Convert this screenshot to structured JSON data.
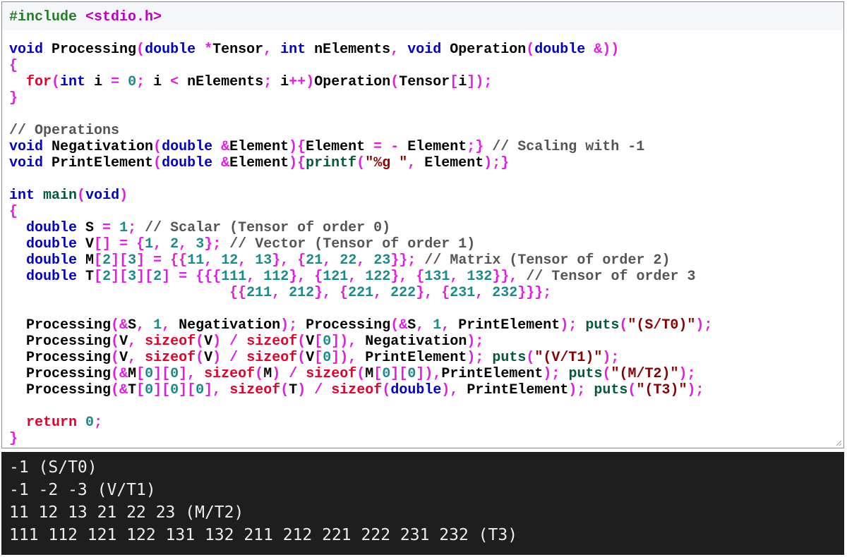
{
  "colors": {
    "editor_bg": "#ffffff",
    "first_line_bg": "#f4f6f9",
    "console_bg": "#1e1e1e",
    "console_text": "#ececec",
    "token_default": "#000000",
    "token_preprocessor": "#267f26",
    "token_include_path": "#c000c0",
    "token_type": "#0000cc",
    "token_keyword": "#e8002a",
    "token_punct": "#e619e6",
    "token_number": "#1a8b8b",
    "token_string": "#8b0000",
    "token_comment": "#555555",
    "token_function": "#005a3c"
  },
  "editor": {
    "code_lines": [
      [
        [
          "#include ",
          "p"
        ],
        [
          "<stdio.h>",
          "ip"
        ]
      ],
      [],
      [
        [
          "void",
          "t"
        ],
        [
          " Processing",
          "d"
        ],
        [
          "(",
          "x"
        ],
        [
          "double",
          "t"
        ],
        [
          " ",
          "d"
        ],
        [
          "*",
          "x"
        ],
        [
          "Tensor",
          "d"
        ],
        [
          ", ",
          "x"
        ],
        [
          "int",
          "t"
        ],
        [
          " nElements",
          "d"
        ],
        [
          ", ",
          "x"
        ],
        [
          "void",
          "t"
        ],
        [
          " Operation",
          "d"
        ],
        [
          "(",
          "x"
        ],
        [
          "double",
          "t"
        ],
        [
          " ",
          "d"
        ],
        [
          "&))",
          "x"
        ]
      ],
      [
        [
          "{",
          "x"
        ]
      ],
      [
        [
          "  ",
          "d"
        ],
        [
          "for",
          "k"
        ],
        [
          "(",
          "x"
        ],
        [
          "int",
          "t"
        ],
        [
          " i ",
          "d"
        ],
        [
          "=",
          "x"
        ],
        [
          " ",
          "d"
        ],
        [
          "0",
          "n"
        ],
        [
          "; ",
          "x"
        ],
        [
          "i ",
          "d"
        ],
        [
          "<",
          "x"
        ],
        [
          " nElements",
          "d"
        ],
        [
          "; ",
          "x"
        ],
        [
          "i",
          "d"
        ],
        [
          "++)",
          "x"
        ],
        [
          "Operation",
          "d"
        ],
        [
          "(",
          "x"
        ],
        [
          "Tensor",
          "d"
        ],
        [
          "[",
          "x"
        ],
        [
          "i",
          "d"
        ],
        [
          "]);",
          "x"
        ]
      ],
      [
        [
          "}",
          "x"
        ]
      ],
      [],
      [
        [
          "// Operations",
          "c"
        ]
      ],
      [
        [
          "void",
          "t"
        ],
        [
          " Negativation",
          "d"
        ],
        [
          "(",
          "x"
        ],
        [
          "double",
          "t"
        ],
        [
          " ",
          "d"
        ],
        [
          "&",
          "x"
        ],
        [
          "Element",
          "d"
        ],
        [
          ")",
          "x"
        ],
        [
          "{",
          "x"
        ],
        [
          "Element ",
          "d"
        ],
        [
          "=",
          "x"
        ],
        [
          " ",
          "d"
        ],
        [
          "-",
          "x"
        ],
        [
          " Element",
          "d"
        ],
        [
          ";}",
          "x"
        ],
        [
          " ",
          "d"
        ],
        [
          "// Scaling with -1",
          "c"
        ]
      ],
      [
        [
          "void",
          "t"
        ],
        [
          " PrintElement",
          "d"
        ],
        [
          "(",
          "x"
        ],
        [
          "double",
          "t"
        ],
        [
          " ",
          "d"
        ],
        [
          "&",
          "x"
        ],
        [
          "Element",
          "d"
        ],
        [
          ")",
          "x"
        ],
        [
          "{",
          "x"
        ],
        [
          "printf",
          "f"
        ],
        [
          "(",
          "x"
        ],
        [
          "\"%g \"",
          "s"
        ],
        [
          ", ",
          "x"
        ],
        [
          "Element",
          "d"
        ],
        [
          ");}",
          "x"
        ]
      ],
      [],
      [
        [
          "int",
          "t"
        ],
        [
          " ",
          "d"
        ],
        [
          "main",
          "f"
        ],
        [
          "(",
          "x"
        ],
        [
          "void",
          "t"
        ],
        [
          ")",
          "x"
        ]
      ],
      [
        [
          "{",
          "x"
        ]
      ],
      [
        [
          "  ",
          "d"
        ],
        [
          "double",
          "t"
        ],
        [
          " S ",
          "d"
        ],
        [
          "=",
          "x"
        ],
        [
          " ",
          "d"
        ],
        [
          "1",
          "n"
        ],
        [
          "; ",
          "x"
        ],
        [
          "// Scalar (Tensor of order 0)",
          "c"
        ]
      ],
      [
        [
          "  ",
          "d"
        ],
        [
          "double",
          "t"
        ],
        [
          " V",
          "d"
        ],
        [
          "[]",
          "x"
        ],
        [
          " ",
          "d"
        ],
        [
          "=",
          "x"
        ],
        [
          " ",
          "d"
        ],
        [
          "{",
          "x"
        ],
        [
          "1",
          "n"
        ],
        [
          ", ",
          "x"
        ],
        [
          "2",
          "n"
        ],
        [
          ", ",
          "x"
        ],
        [
          "3",
          "n"
        ],
        [
          "};",
          "x"
        ],
        [
          " ",
          "d"
        ],
        [
          "// Vector (Tensor of order 1)",
          "c"
        ]
      ],
      [
        [
          "  ",
          "d"
        ],
        [
          "double",
          "t"
        ],
        [
          " M",
          "d"
        ],
        [
          "[",
          "x"
        ],
        [
          "2",
          "n"
        ],
        [
          "][",
          "x"
        ],
        [
          "3",
          "n"
        ],
        [
          "]",
          "x"
        ],
        [
          " ",
          "d"
        ],
        [
          "=",
          "x"
        ],
        [
          " ",
          "d"
        ],
        [
          "{{",
          "x"
        ],
        [
          "11",
          "n"
        ],
        [
          ", ",
          "x"
        ],
        [
          "12",
          "n"
        ],
        [
          ", ",
          "x"
        ],
        [
          "13",
          "n"
        ],
        [
          "}, {",
          "x"
        ],
        [
          "21",
          "n"
        ],
        [
          ", ",
          "x"
        ],
        [
          "22",
          "n"
        ],
        [
          ", ",
          "x"
        ],
        [
          "23",
          "n"
        ],
        [
          "}};",
          "x"
        ],
        [
          " ",
          "d"
        ],
        [
          "// Matrix (Tensor of order 2)",
          "c"
        ]
      ],
      [
        [
          "  ",
          "d"
        ],
        [
          "double",
          "t"
        ],
        [
          " T",
          "d"
        ],
        [
          "[",
          "x"
        ],
        [
          "2",
          "n"
        ],
        [
          "][",
          "x"
        ],
        [
          "3",
          "n"
        ],
        [
          "][",
          "x"
        ],
        [
          "2",
          "n"
        ],
        [
          "]",
          "x"
        ],
        [
          " ",
          "d"
        ],
        [
          "=",
          "x"
        ],
        [
          " ",
          "d"
        ],
        [
          "{{{",
          "x"
        ],
        [
          "111",
          "n"
        ],
        [
          ", ",
          "x"
        ],
        [
          "112",
          "n"
        ],
        [
          "}, {",
          "x"
        ],
        [
          "121",
          "n"
        ],
        [
          ", ",
          "x"
        ],
        [
          "122",
          "n"
        ],
        [
          "}, {",
          "x"
        ],
        [
          "131",
          "n"
        ],
        [
          ", ",
          "x"
        ],
        [
          "132",
          "n"
        ],
        [
          "}},",
          "x"
        ],
        [
          " ",
          "d"
        ],
        [
          "// Tensor of order 3",
          "c"
        ]
      ],
      [
        [
          "                          ",
          "d"
        ],
        [
          "{{",
          "x"
        ],
        [
          "211",
          "n"
        ],
        [
          ", ",
          "x"
        ],
        [
          "212",
          "n"
        ],
        [
          "}, {",
          "x"
        ],
        [
          "221",
          "n"
        ],
        [
          ", ",
          "x"
        ],
        [
          "222",
          "n"
        ],
        [
          "}, {",
          "x"
        ],
        [
          "231",
          "n"
        ],
        [
          ", ",
          "x"
        ],
        [
          "232",
          "n"
        ],
        [
          "}}};",
          "x"
        ]
      ],
      [],
      [
        [
          "  ",
          "d"
        ],
        [
          "Processing",
          "d"
        ],
        [
          "(&",
          "x"
        ],
        [
          "S",
          "d"
        ],
        [
          ", ",
          "x"
        ],
        [
          "1",
          "n"
        ],
        [
          ", ",
          "x"
        ],
        [
          "Negativation",
          "d"
        ],
        [
          "); ",
          "x"
        ],
        [
          "Processing",
          "d"
        ],
        [
          "(&",
          "x"
        ],
        [
          "S",
          "d"
        ],
        [
          ", ",
          "x"
        ],
        [
          "1",
          "n"
        ],
        [
          ", ",
          "x"
        ],
        [
          "PrintElement",
          "d"
        ],
        [
          "); ",
          "x"
        ],
        [
          "puts",
          "f"
        ],
        [
          "(",
          "x"
        ],
        [
          "\"(S/T0)\"",
          "s"
        ],
        [
          ");",
          "x"
        ]
      ],
      [
        [
          "  ",
          "d"
        ],
        [
          "Processing",
          "d"
        ],
        [
          "(",
          "x"
        ],
        [
          "V",
          "d"
        ],
        [
          ", ",
          "x"
        ],
        [
          "sizeof",
          "k"
        ],
        [
          "(",
          "x"
        ],
        [
          "V",
          "d"
        ],
        [
          ")",
          "x"
        ],
        [
          " ",
          "d"
        ],
        [
          "/",
          "x"
        ],
        [
          " ",
          "d"
        ],
        [
          "sizeof",
          "k"
        ],
        [
          "(",
          "x"
        ],
        [
          "V",
          "d"
        ],
        [
          "[",
          "x"
        ],
        [
          "0",
          "n"
        ],
        [
          "]), ",
          "x"
        ],
        [
          "Negativation",
          "d"
        ],
        [
          ");",
          "x"
        ]
      ],
      [
        [
          "  ",
          "d"
        ],
        [
          "Processing",
          "d"
        ],
        [
          "(",
          "x"
        ],
        [
          "V",
          "d"
        ],
        [
          ", ",
          "x"
        ],
        [
          "sizeof",
          "k"
        ],
        [
          "(",
          "x"
        ],
        [
          "V",
          "d"
        ],
        [
          ")",
          "x"
        ],
        [
          " ",
          "d"
        ],
        [
          "/",
          "x"
        ],
        [
          " ",
          "d"
        ],
        [
          "sizeof",
          "k"
        ],
        [
          "(",
          "x"
        ],
        [
          "V",
          "d"
        ],
        [
          "[",
          "x"
        ],
        [
          "0",
          "n"
        ],
        [
          "]), ",
          "x"
        ],
        [
          "PrintElement",
          "d"
        ],
        [
          "); ",
          "x"
        ],
        [
          "puts",
          "f"
        ],
        [
          "(",
          "x"
        ],
        [
          "\"(V/T1)\"",
          "s"
        ],
        [
          ");",
          "x"
        ]
      ],
      [
        [
          "  ",
          "d"
        ],
        [
          "Processing",
          "d"
        ],
        [
          "(&",
          "x"
        ],
        [
          "M",
          "d"
        ],
        [
          "[",
          "x"
        ],
        [
          "0",
          "n"
        ],
        [
          "][",
          "x"
        ],
        [
          "0",
          "n"
        ],
        [
          "], ",
          "x"
        ],
        [
          "sizeof",
          "k"
        ],
        [
          "(",
          "x"
        ],
        [
          "M",
          "d"
        ],
        [
          ")",
          "x"
        ],
        [
          " ",
          "d"
        ],
        [
          "/",
          "x"
        ],
        [
          " ",
          "d"
        ],
        [
          "sizeof",
          "k"
        ],
        [
          "(",
          "x"
        ],
        [
          "M",
          "d"
        ],
        [
          "[",
          "x"
        ],
        [
          "0",
          "n"
        ],
        [
          "][",
          "x"
        ],
        [
          "0",
          "n"
        ],
        [
          "]),",
          "x"
        ],
        [
          "PrintElement",
          "d"
        ],
        [
          "); ",
          "x"
        ],
        [
          "puts",
          "f"
        ],
        [
          "(",
          "x"
        ],
        [
          "\"(M/T2)\"",
          "s"
        ],
        [
          ");",
          "x"
        ]
      ],
      [
        [
          "  ",
          "d"
        ],
        [
          "Processing",
          "d"
        ],
        [
          "(&",
          "x"
        ],
        [
          "T",
          "d"
        ],
        [
          "[",
          "x"
        ],
        [
          "0",
          "n"
        ],
        [
          "][",
          "x"
        ],
        [
          "0",
          "n"
        ],
        [
          "][",
          "x"
        ],
        [
          "0",
          "n"
        ],
        [
          "], ",
          "x"
        ],
        [
          "sizeof",
          "k"
        ],
        [
          "(",
          "x"
        ],
        [
          "T",
          "d"
        ],
        [
          ")",
          "x"
        ],
        [
          " ",
          "d"
        ],
        [
          "/",
          "x"
        ],
        [
          " ",
          "d"
        ],
        [
          "sizeof",
          "k"
        ],
        [
          "(",
          "x"
        ],
        [
          "double",
          "t"
        ],
        [
          "), ",
          "x"
        ],
        [
          "PrintElement",
          "d"
        ],
        [
          "); ",
          "x"
        ],
        [
          "puts",
          "f"
        ],
        [
          "(",
          "x"
        ],
        [
          "\"(T3)\"",
          "s"
        ],
        [
          ");",
          "x"
        ]
      ],
      [],
      [
        [
          "  ",
          "d"
        ],
        [
          "return",
          "k"
        ],
        [
          " ",
          "d"
        ],
        [
          "0",
          "n"
        ],
        [
          ";",
          "x"
        ]
      ],
      [
        [
          "}",
          "x"
        ]
      ]
    ]
  },
  "console": {
    "lines": [
      "-1 (S/T0)",
      "-1 -2 -3 (V/T1)",
      "11 12 13 21 22 23 (M/T2)",
      "111 112 121 122 131 132 211 212 221 222 231 232 (T3)"
    ]
  }
}
